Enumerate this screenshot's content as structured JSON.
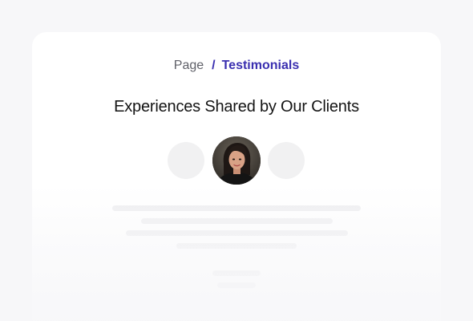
{
  "breadcrumb": {
    "parent_label": "Page",
    "separator": "/",
    "current_label": "Testimonials"
  },
  "section": {
    "title": "Experiences Shared by Our Clients"
  },
  "carousel": {
    "active_index": 1,
    "count": 3
  },
  "colors": {
    "accent": "#3a2fb0",
    "text_dark": "#141414",
    "text_muted": "#5f6068",
    "page_bg": "#f7f7f9",
    "card_bg": "#ffffff",
    "placeholder": "#efeff1"
  }
}
